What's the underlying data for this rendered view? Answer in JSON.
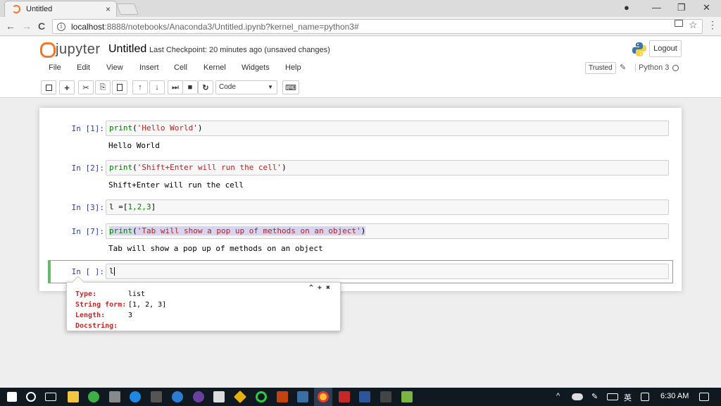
{
  "browser": {
    "tab_title": "Untitled",
    "tab_close": "×",
    "url_host": "localhost",
    "url_path": ":8888/notebooks/Anaconda3/Untitled.ipynb?kernel_name=python3#",
    "back": "←",
    "forward": "→",
    "reload": "C",
    "info": "i",
    "star": "☆",
    "menu": "⋮",
    "account": "●",
    "minimize": "—",
    "restore": "❐",
    "close": "✕"
  },
  "jupyter": {
    "logo_text": "jupyter",
    "notebook_name": "Untitled",
    "checkpoint": "Last Checkpoint: 20 minutes ago (unsaved changes)",
    "logout": "Logout",
    "menu": [
      "File",
      "Edit",
      "View",
      "Insert",
      "Cell",
      "Kernel",
      "Widgets",
      "Help"
    ],
    "trusted": "Trusted",
    "kernel_name": "Python 3",
    "toolbar": {
      "save": "💾",
      "add": "+",
      "cut": "✂",
      "copy": "⎘",
      "paste": "📋",
      "up": "↑",
      "down": "↓",
      "run": "⏭",
      "stop": "■",
      "restart": "↻",
      "cell_type": "Code",
      "keyboard": "⌨"
    }
  },
  "cells": [
    {
      "prompt": "In [1]:",
      "code_fn": "print",
      "code_str": "'Hello World'",
      "output": "Hello World"
    },
    {
      "prompt": "In [2]:",
      "code_fn": "print",
      "code_str": "'Shift+Enter will run the cell'",
      "output": "Shift+Enter will run the cell"
    },
    {
      "prompt": "In [3]:",
      "code_pre": "l =[",
      "code_nums": "1,2,3",
      "code_post": "]"
    },
    {
      "prompt": "In [7]:",
      "code_fn": "print",
      "code_str": "'Tab will show a pop up of methods on an object'",
      "output": "Tab will show a pop up of methods on an object"
    },
    {
      "prompt": "In [ ]:",
      "code": "l"
    }
  ],
  "tooltip": {
    "controls": "^ + ✖",
    "type_label": "Type:",
    "type_value": "list",
    "form_label": "String form:",
    "form_value": "[1, 2, 3]",
    "length_label": "Length:",
    "length_value": "3",
    "doc_label": "Docstring:"
  },
  "taskbar": {
    "time": "6:30 AM",
    "ime": "英"
  }
}
